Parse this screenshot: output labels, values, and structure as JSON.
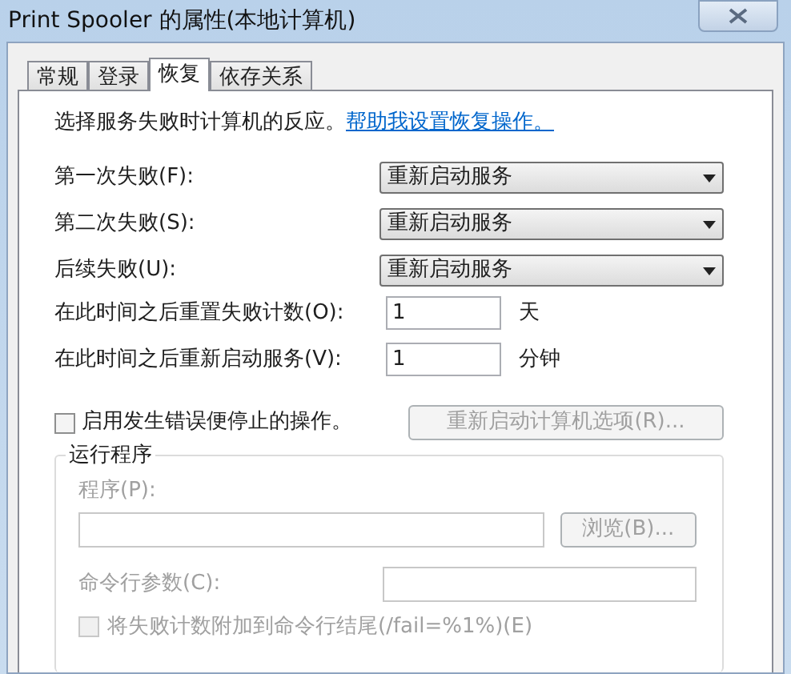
{
  "window": {
    "title": "Print Spooler 的属性(本地计算机)"
  },
  "tabs": [
    {
      "label": "常规",
      "selected": false
    },
    {
      "label": "登录",
      "selected": false
    },
    {
      "label": "恢复",
      "selected": true
    },
    {
      "label": "依存关系",
      "selected": false
    }
  ],
  "intro": {
    "text": "选择服务失败时计算机的反应。",
    "link": "帮助我设置恢复操作。"
  },
  "failure_actions": [
    {
      "label": "第一次失败(F):",
      "value": "重新启动服务"
    },
    {
      "label": "第二次失败(S):",
      "value": "重新启动服务"
    },
    {
      "label": "后续失败(U):",
      "value": "重新启动服务"
    }
  ],
  "timings": [
    {
      "label": "在此时间之后重置失败计数(O):",
      "value": "1",
      "unit": "天"
    },
    {
      "label": "在此时间之后重新启动服务(V):",
      "value": "1",
      "unit": "分钟"
    }
  ],
  "stop_actions": {
    "label": "启用发生错误便停止的操作。",
    "checked": false
  },
  "restart_options_button": {
    "label": "重新启动计算机选项(R)...",
    "disabled": true
  },
  "run_program": {
    "title": "运行程序",
    "disabled": true,
    "program_label": "程序(P):",
    "browse_button": "浏览(B)...",
    "params_label": "命令行参数(C):",
    "append_fail_count": {
      "label": "将失败计数附加到命令行结尾(/fail=%1%)(E)",
      "checked": false
    }
  }
}
